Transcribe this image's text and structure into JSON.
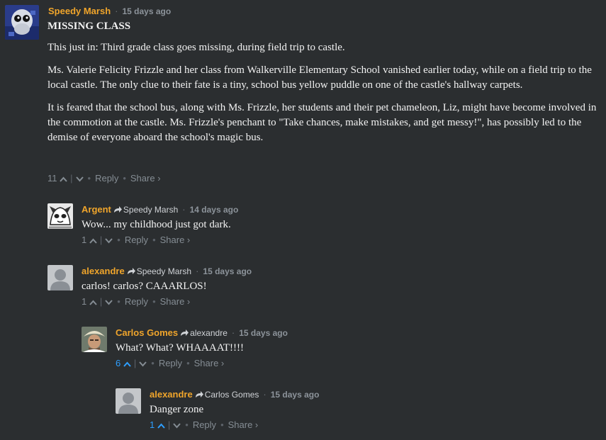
{
  "comments": [
    {
      "author": "Speedy Marsh",
      "time": "15 days ago",
      "title": "MISSING CLASS",
      "paragraphs": [
        "This just in: Third grade class goes missing, during field trip to castle.",
        "Ms. Valerie Felicity Frizzle and her class from Walkerville Elementary School vanished earlier today, while on a field trip to the local castle. The only clue to their fate is a tiny, school bus yellow puddle on one of the castle's hallway carpets.",
        "It is feared that the school bus, along with Ms. Frizzle, her students and their pet chameleon, Liz, might have become involved in the commotion at the castle. Ms. Frizzle's penchant to \"Take chances, make mistakes, and get messy!\", has possibly led to the demise of everyone aboard the school's magic bus."
      ],
      "votes": "11",
      "reply_label": "Reply",
      "share_label": "Share ›"
    },
    {
      "author": "Argent",
      "reply_to": "Speedy Marsh",
      "time": "14 days ago",
      "text": "Wow... my childhood just got dark.",
      "votes": "1",
      "reply_label": "Reply",
      "share_label": "Share ›"
    },
    {
      "author": "alexandre",
      "reply_to": "Speedy Marsh",
      "time": "15 days ago",
      "text": "carlos! carlos? CAAARLOS!",
      "votes": "1",
      "reply_label": "Reply",
      "share_label": "Share ›"
    },
    {
      "author": "Carlos Gomes",
      "reply_to": "alexandre",
      "time": "15 days ago",
      "text": "What? What? WHAAAAT!!!!",
      "votes": "6",
      "reply_label": "Reply",
      "share_label": "Share ›"
    },
    {
      "author": "alexandre",
      "reply_to": "Carlos Gomes",
      "time": "15 days ago",
      "text": "Danger zone",
      "votes": "1",
      "reply_label": "Reply",
      "share_label": "Share ›"
    }
  ],
  "colors": {
    "author": "#f0a52b",
    "upvoted": "#2e9fff",
    "background": "#2b2e30"
  },
  "icons": [
    "reply-arrow-icon",
    "upvote-icon",
    "downvote-icon"
  ]
}
